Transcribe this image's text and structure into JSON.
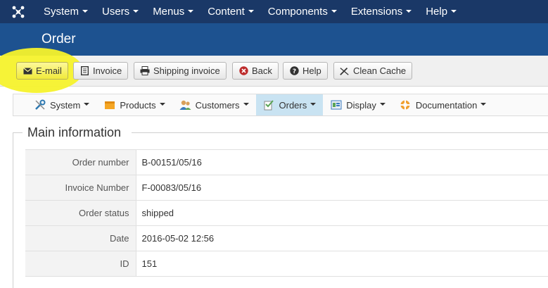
{
  "top_menu": {
    "items": [
      {
        "label": "System"
      },
      {
        "label": "Users"
      },
      {
        "label": "Menus"
      },
      {
        "label": "Content"
      },
      {
        "label": "Components"
      },
      {
        "label": "Extensions"
      },
      {
        "label": "Help"
      }
    ]
  },
  "page": {
    "title": "Order"
  },
  "toolbar": {
    "email": "E-mail",
    "invoice": "Invoice",
    "shipping_invoice": "Shipping invoice",
    "back": "Back",
    "help": "Help",
    "clean_cache": "Clean Cache"
  },
  "submenu": {
    "items": [
      {
        "label": "System",
        "icon": "wrench-icon"
      },
      {
        "label": "Products",
        "icon": "box-icon"
      },
      {
        "label": "Customers",
        "icon": "users-icon"
      },
      {
        "label": "Orders",
        "icon": "orders-icon",
        "active": true
      },
      {
        "label": "Display",
        "icon": "display-icon"
      },
      {
        "label": "Documentation",
        "icon": "help-lifebuoy-icon"
      }
    ]
  },
  "main_info": {
    "legend": "Main information",
    "rows": [
      {
        "label": "Order number",
        "value": "B-00151/05/16"
      },
      {
        "label": "Invoice Number",
        "value": "F-00083/05/16"
      },
      {
        "label": "Order status",
        "value": "shipped"
      },
      {
        "label": "Date",
        "value": "2016-05-02 12:56"
      },
      {
        "label": "ID",
        "value": "151"
      }
    ]
  },
  "colors": {
    "top_bar": "#1a3867",
    "title_bar": "#1d5290",
    "highlight": "#f6f22c",
    "active_submenu": "#c9e3f2"
  }
}
